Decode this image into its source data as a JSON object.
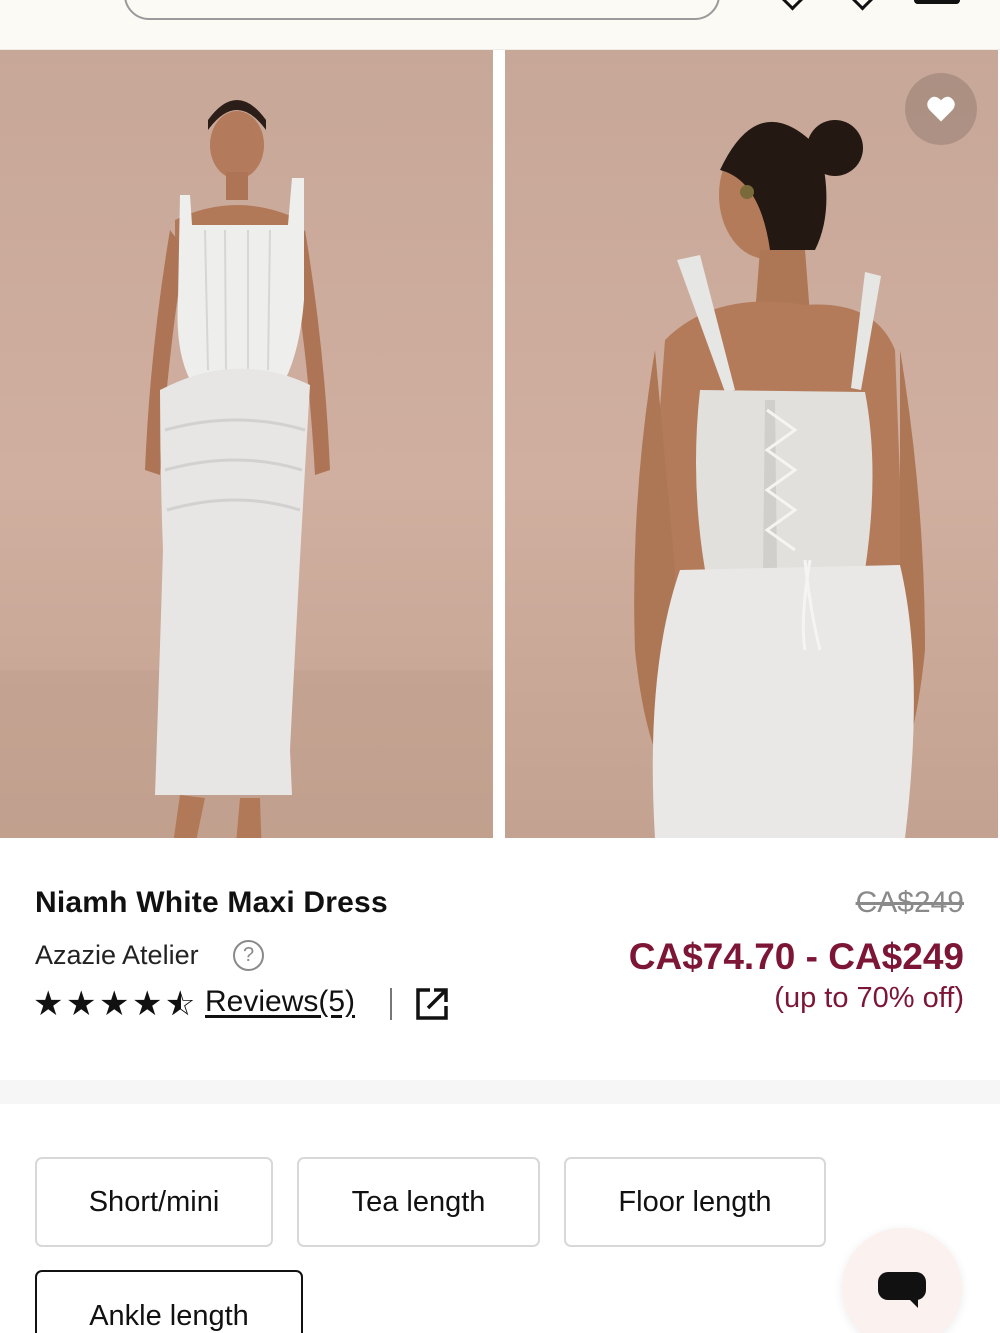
{
  "product": {
    "title": "Niamh White Maxi Dress",
    "brand": "Azazie Atelier",
    "rating": 4.5,
    "rating_max": 5,
    "reviews_label": "Reviews(5)",
    "price_original": "CA$249",
    "price_range": "CA$74.70 - CA$249",
    "discount_note": "(up to 70% off)"
  },
  "gallery": {
    "images": [
      {
        "alt": "front view"
      },
      {
        "alt": "back view"
      }
    ]
  },
  "length_options": [
    "Short/mini",
    "Tea length",
    "Floor length",
    "Ankle length"
  ],
  "colors": {
    "price_accent": "#7d1537",
    "photo_background": "#c9a898"
  },
  "icons": {
    "favorite": "heart-icon",
    "help": "question-circle-icon",
    "share": "external-link-icon",
    "chat": "chat-icon"
  }
}
